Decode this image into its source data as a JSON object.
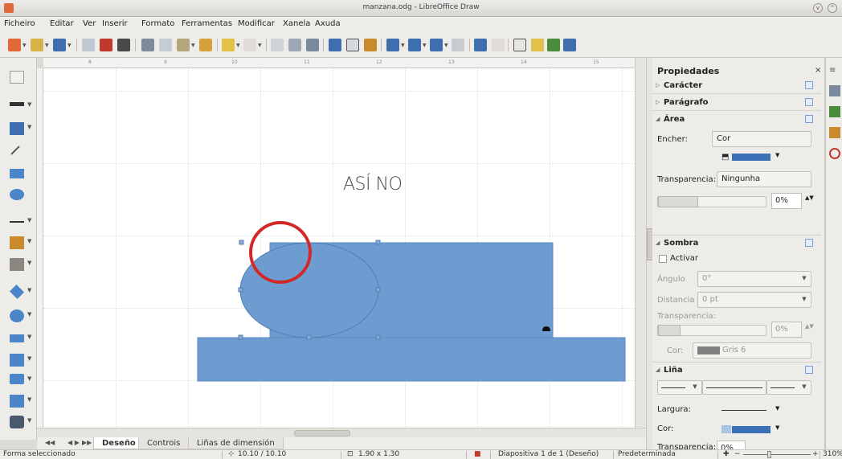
{
  "window": {
    "title": "manzana.odg - LibreOffice Draw"
  },
  "menubar": {
    "items": [
      "Ficheiro",
      "Editar",
      "Ver",
      "Inserir",
      "Formato",
      "Ferramentas",
      "Modificar",
      "Xanela",
      "Axuda"
    ]
  },
  "ruler": {
    "ticks": [
      "8",
      "9",
      "10",
      "11",
      "12",
      "13",
      "14",
      "15"
    ]
  },
  "canvas": {
    "annotation": "ASÍ NO"
  },
  "colors": {
    "shape_fill": "#6d9dd0",
    "shape_stroke": "#4f7fb5",
    "highlight_circle": "#d22828",
    "area_color": "#3b6fb6",
    "shadow_color": "#808080"
  },
  "sidebar": {
    "title": "Propiedades",
    "close": "×",
    "sections": {
      "character": "Carácter",
      "paragraph": "Parágrafo",
      "area": "Área",
      "shadow": "Sombra",
      "line": "Liña"
    },
    "area": {
      "fill_label": "Encher:",
      "fill_value": "Cor",
      "transparency_label": "Transparencia:",
      "transparency_value": "Ningunha",
      "percent": "0%"
    },
    "shadow": {
      "enable_label": "Activar",
      "angle_label": "Ángulo",
      "angle_value": "0°",
      "distance_label": "Distancia",
      "distance_value": "0 pt",
      "transparency_label": "Transparencia:",
      "percent": "0%",
      "color_label": "Cor:",
      "color_value": "Gris 6"
    },
    "line": {
      "width_label": "Largura:",
      "color_label": "Cor:",
      "transparency_label": "Transparencia:",
      "transparency_value": "0%"
    }
  },
  "tabs": {
    "items": [
      "Deseño",
      "Controis",
      "Liñas de dimensión"
    ],
    "active": "Deseño"
  },
  "statusbar": {
    "status": "Forma seleccionado",
    "position": "10.10 / 10.10",
    "size": "1.90 x 1.30",
    "slide": "Diapositiva 1 de 1 (Deseño)",
    "master": "Predeterminada",
    "zoom": "310%"
  }
}
